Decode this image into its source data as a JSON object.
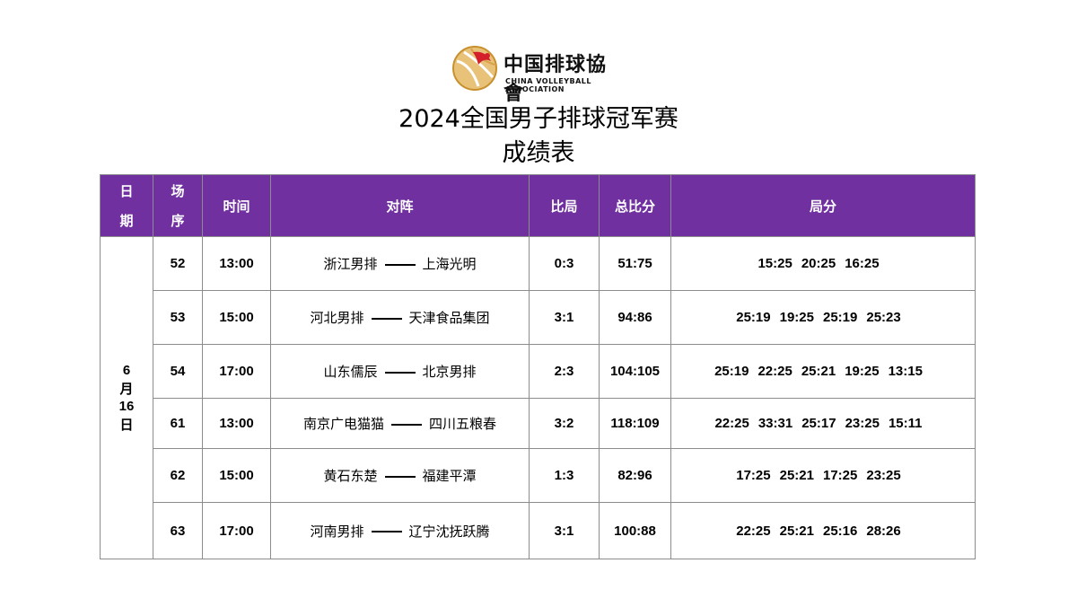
{
  "header": {
    "logo_cn": "中国排球協會",
    "logo_en": "CHINA VOLLEYBALL ASSOCIATION",
    "title": "2024全国男子排球冠军赛",
    "subtitle": "成绩表"
  },
  "columns": {
    "date_top": "日",
    "date_bottom": "期",
    "match_top": "场",
    "match_bottom": "序",
    "time": "时间",
    "matchup": "对阵",
    "sets": "比局",
    "total": "总比分",
    "set_scores": "局分"
  },
  "date": {
    "month": "6",
    "month_unit": "月",
    "day": "16",
    "day_unit": "日"
  },
  "colors": {
    "header_bg": "#7030a0",
    "header_text": "#ffffff",
    "border": "#8c8c8c"
  },
  "rows": [
    {
      "match": "52",
      "time": "13:00",
      "home": "浙江男排",
      "away": "上海光明",
      "sets": "0:3",
      "total": "51:75",
      "set_scores": [
        "15:25",
        "20:25",
        "16:25"
      ]
    },
    {
      "match": "53",
      "time": "15:00",
      "home": "河北男排",
      "away": "天津食品集团",
      "sets": "3:1",
      "total": "94:86",
      "set_scores": [
        "25:19",
        "19:25",
        "25:19",
        "25:23"
      ]
    },
    {
      "match": "54",
      "time": "17:00",
      "home": "山东儒辰",
      "away": "北京男排",
      "sets": "2:3",
      "total": "104:105",
      "set_scores": [
        "25:19",
        "22:25",
        "25:21",
        "19:25",
        "13:15"
      ]
    },
    {
      "match": "61",
      "time": "13:00",
      "home": "南京广电猫猫",
      "away": "四川五粮春",
      "sets": "3:2",
      "total": "118:109",
      "set_scores": [
        "22:25",
        "33:31",
        "25:17",
        "23:25",
        "15:11"
      ]
    },
    {
      "match": "62",
      "time": "15:00",
      "home": "黄石东楚",
      "away": "福建平潭",
      "sets": "1:3",
      "total": "82:96",
      "set_scores": [
        "17:25",
        "25:21",
        "17:25",
        "23:25"
      ]
    },
    {
      "match": "63",
      "time": "17:00",
      "home": "河南男排",
      "away": "辽宁沈抚跃腾",
      "sets": "3:1",
      "total": "100:88",
      "set_scores": [
        "22:25",
        "25:21",
        "25:16",
        "28:26"
      ]
    }
  ]
}
